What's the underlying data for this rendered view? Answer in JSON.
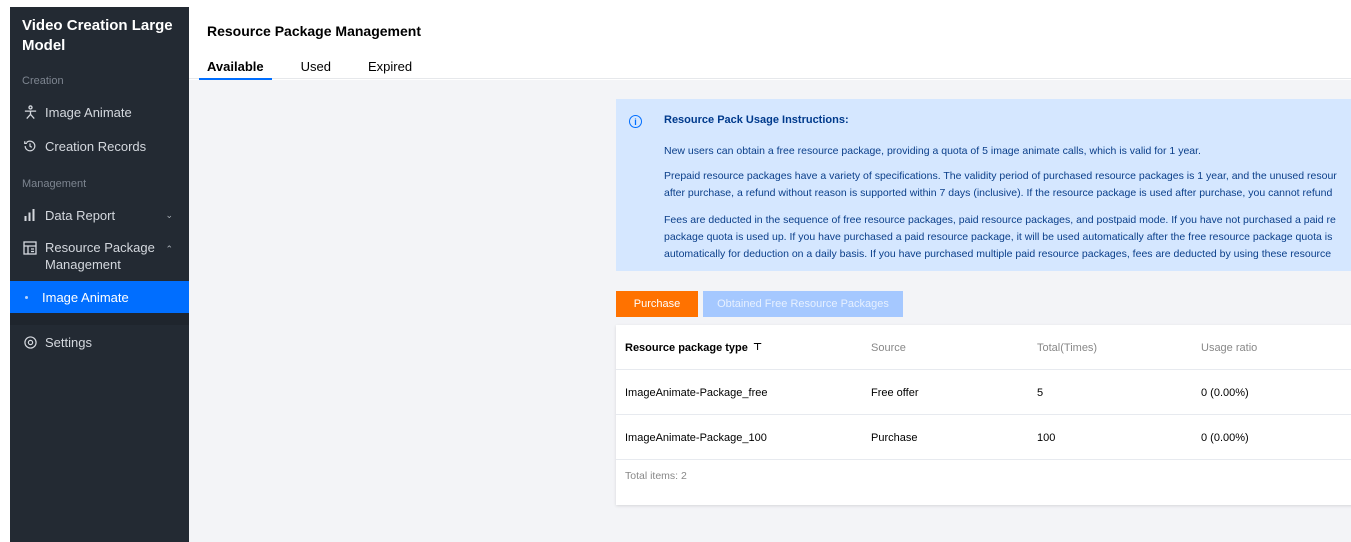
{
  "sidebar": {
    "title_line1": "Video Creation Large",
    "title_line2": "Model",
    "section_creation": "Creation",
    "item_image_animate": "Image Animate",
    "item_creation_records": "Creation Records",
    "section_management": "Management",
    "item_data_report": "Data Report",
    "item_resource_pkg_line1": "Resource Package",
    "item_resource_pkg_line2": "Management",
    "sub_image_animate": "Image Animate",
    "item_settings": "Settings"
  },
  "header": {
    "title": "Resource Package Management",
    "tabs": [
      "Available",
      "Used",
      "Expired"
    ]
  },
  "notice": {
    "title": "Resource Pack Usage Instructions:",
    "p1": "New users can obtain a free resource package, providing a quota of 5 image animate calls, which is valid for 1 year.",
    "p2_l1": "Prepaid resource packages have a variety of specifications. The validity period of purchased resource packages is 1 year, and the unused resour",
    "p2_l2": "after purchase, a refund without reason is supported within 7 days (inclusive). If the resource package is used after purchase, you cannot refund",
    "p3_l1": "Fees are deducted in the sequence of free resource packages, paid resource packages, and postpaid mode. If you have not purchased a paid re",
    "p3_l2": "package quota is used up. If you have purchased a paid resource package, it will be used automatically after the free resource package quota is",
    "p3_l3": "automatically for deduction on a daily basis. If you have purchased multiple paid resource packages, fees are deducted by using these resource"
  },
  "buttons": {
    "purchase": "Purchase",
    "obtained_free": "Obtained Free Resource Packages"
  },
  "table": {
    "headers": [
      "Resource package type",
      "Source",
      "Total(Times)",
      "Usage ratio"
    ],
    "rows": [
      [
        "ImageAnimate-Package_free",
        "Free offer",
        "5",
        "0 (0.00%)"
      ],
      [
        "ImageAnimate-Package_100",
        "Purchase",
        "100",
        "0 (0.00%)"
      ]
    ],
    "total": "Total items: 2"
  },
  "colors": {
    "sidebar_bg": "#232a33",
    "accent": "#006eff",
    "purchase": "#ff7200",
    "notice_bg": "#d5e7ff"
  }
}
